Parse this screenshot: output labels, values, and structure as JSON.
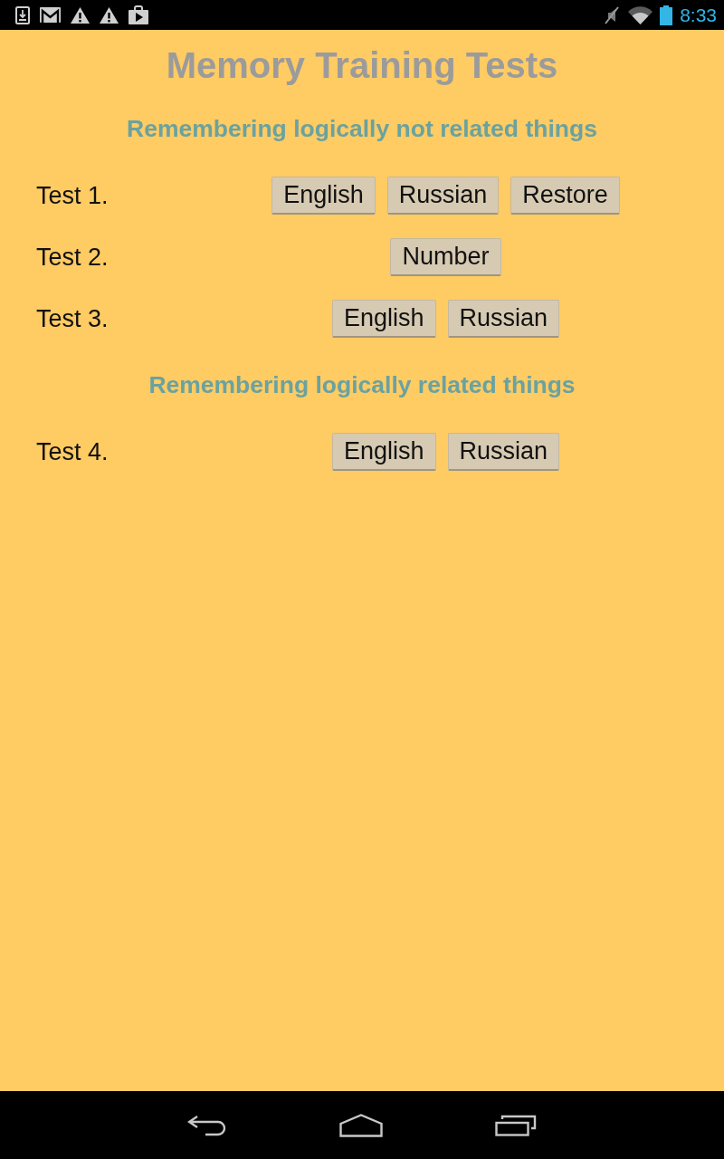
{
  "status_bar": {
    "time": "8:33"
  },
  "title": "Memory Training Tests",
  "sections": [
    {
      "heading": "Remembering logically not related things",
      "tests": [
        {
          "label": "Test 1.",
          "buttons": [
            "English",
            "Russian",
            "Restore"
          ]
        },
        {
          "label": "Test 2.",
          "buttons": [
            "Number"
          ]
        },
        {
          "label": "Test 3.",
          "buttons": [
            "English",
            "Russian"
          ]
        }
      ]
    },
    {
      "heading": "Remembering logically related things",
      "tests": [
        {
          "label": "Test 4.",
          "buttons": [
            "English",
            "Russian"
          ]
        }
      ]
    }
  ]
}
